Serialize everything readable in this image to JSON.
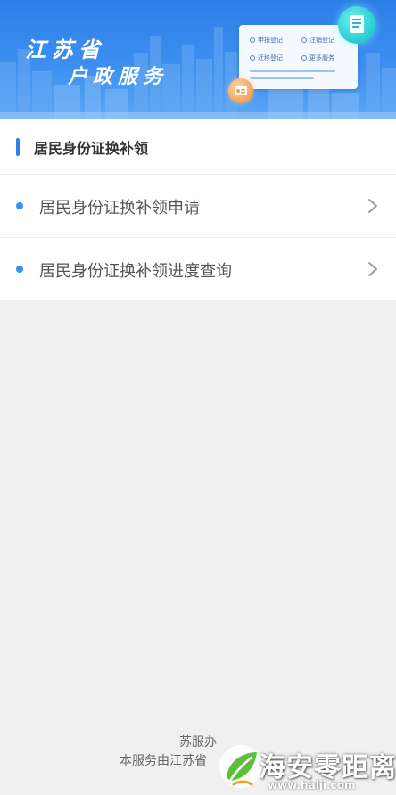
{
  "banner": {
    "title_line1": "江苏省",
    "title_line2": "户政服务",
    "card_items": [
      "申报登记",
      "注销登记",
      "迁移登记",
      "更多服务"
    ],
    "colors": {
      "primary": "#2f7ee8",
      "accent_cyan": "#2fd0d6",
      "accent_orange": "#f7a45c"
    },
    "icons": [
      "document-icon",
      "id-card-icon"
    ]
  },
  "section": {
    "title": "居民身份证换补领",
    "accent_color": "#2d7ff0"
  },
  "list": {
    "items": [
      {
        "label": "居民身份证换补领申请"
      },
      {
        "label": "居民身份证换补领进度查询"
      }
    ],
    "bullet_color": "#3a8ef6",
    "chevron_icon": "chevron-right-icon"
  },
  "footer": {
    "line1": "苏服办",
    "line2": "本服务由江苏省"
  },
  "watermark": {
    "brand": "海安零距离",
    "url": "www.halji.com"
  }
}
